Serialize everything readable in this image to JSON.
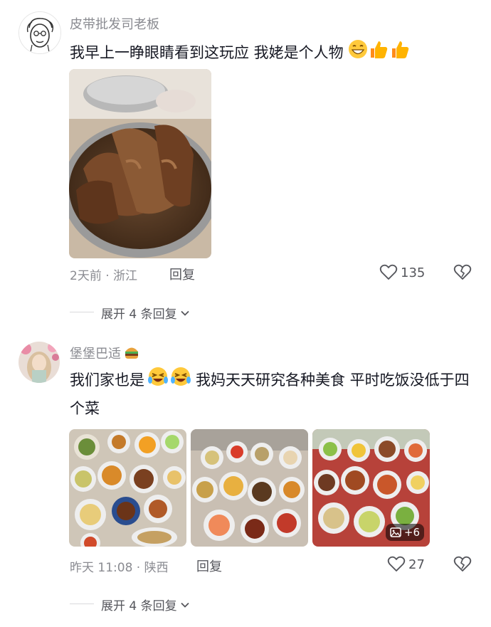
{
  "comments": [
    {
      "username": "皮带批发司老板",
      "text": "我早上一睁眼睛看到这玩应  我姥是个人物",
      "time_location": "2天前 · 浙江",
      "reply_label": "回复",
      "like_count": "135",
      "expand_label": "展开 4 条回复"
    },
    {
      "username": "堡堡巴适",
      "text_part1": "我们家也是",
      "text_part2": "我妈天天研究各种美食 平时吃饭没低于四个菜",
      "time_location": "昨天 11:08 · 陕西",
      "reply_label": "回复",
      "like_count": "27",
      "more_images": "+6",
      "expand_label": "展开 4 条回复"
    }
  ],
  "icons": {
    "like": "heart-outline-icon",
    "dislike": "broken-heart-icon",
    "chevron": "chevron-down-icon"
  },
  "colors": {
    "text_primary": "#161823",
    "text_secondary": "#8a8b91"
  }
}
